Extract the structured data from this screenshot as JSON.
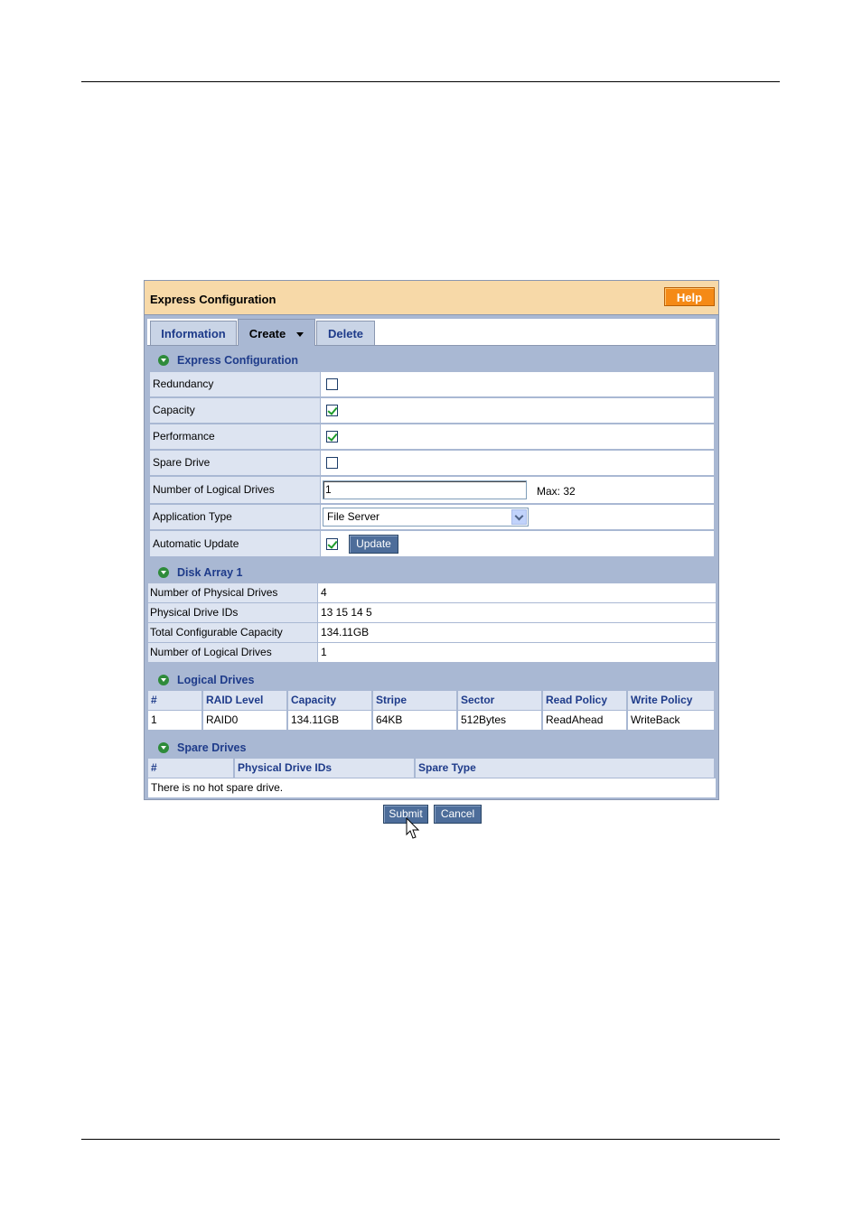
{
  "panel": {
    "title": "Express Configuration",
    "help_label": "Help"
  },
  "tabs": [
    {
      "label": "Information",
      "active": false
    },
    {
      "label": "Create",
      "active": true
    },
    {
      "label": "Delete",
      "active": false
    }
  ],
  "express": {
    "section_title": "Express Configuration",
    "redundancy": {
      "label": "Redundancy",
      "checked": false
    },
    "capacity": {
      "label": "Capacity",
      "checked": true
    },
    "performance": {
      "label": "Performance",
      "checked": true
    },
    "spare_drive": {
      "label": "Spare Drive",
      "checked": false
    },
    "num_logical": {
      "label": "Number of Logical Drives",
      "value": "1",
      "max_text": "Max: 32"
    },
    "app_type": {
      "label": "Application Type",
      "value": "File Server"
    },
    "auto_update": {
      "label": "Automatic Update",
      "checked": true,
      "button_label": "Update"
    }
  },
  "disk_array": {
    "section_title": "Disk Array 1",
    "rows": [
      {
        "label": "Number of Physical Drives",
        "value": "4"
      },
      {
        "label": "Physical Drive IDs",
        "value": "13 15 14 5"
      },
      {
        "label": "Total Configurable Capacity",
        "value": "134.11GB"
      },
      {
        "label": "Number of Logical Drives",
        "value": "1"
      }
    ]
  },
  "logical_drives": {
    "section_title": "Logical Drives",
    "headers": [
      "#",
      "RAID Level",
      "Capacity",
      "Stripe",
      "Sector",
      "Read Policy",
      "Write Policy"
    ],
    "rows": [
      [
        "1",
        "RAID0",
        "134.11GB",
        "64KB",
        "512Bytes",
        "ReadAhead",
        "WriteBack"
      ]
    ]
  },
  "spare_drives": {
    "section_title": "Spare Drives",
    "headers": [
      "#",
      "Physical Drive IDs",
      "Spare Type"
    ],
    "empty_text": "There is no hot spare drive."
  },
  "actions": {
    "submit_label": "Submit",
    "cancel_label": "Cancel"
  },
  "colors": {
    "header_bg": "#f7d9a8",
    "help_button": "#f58a16",
    "section_bg": "#a9b8d3",
    "label_bg": "#dde4f1",
    "accent_text": "#1e3b8a"
  }
}
